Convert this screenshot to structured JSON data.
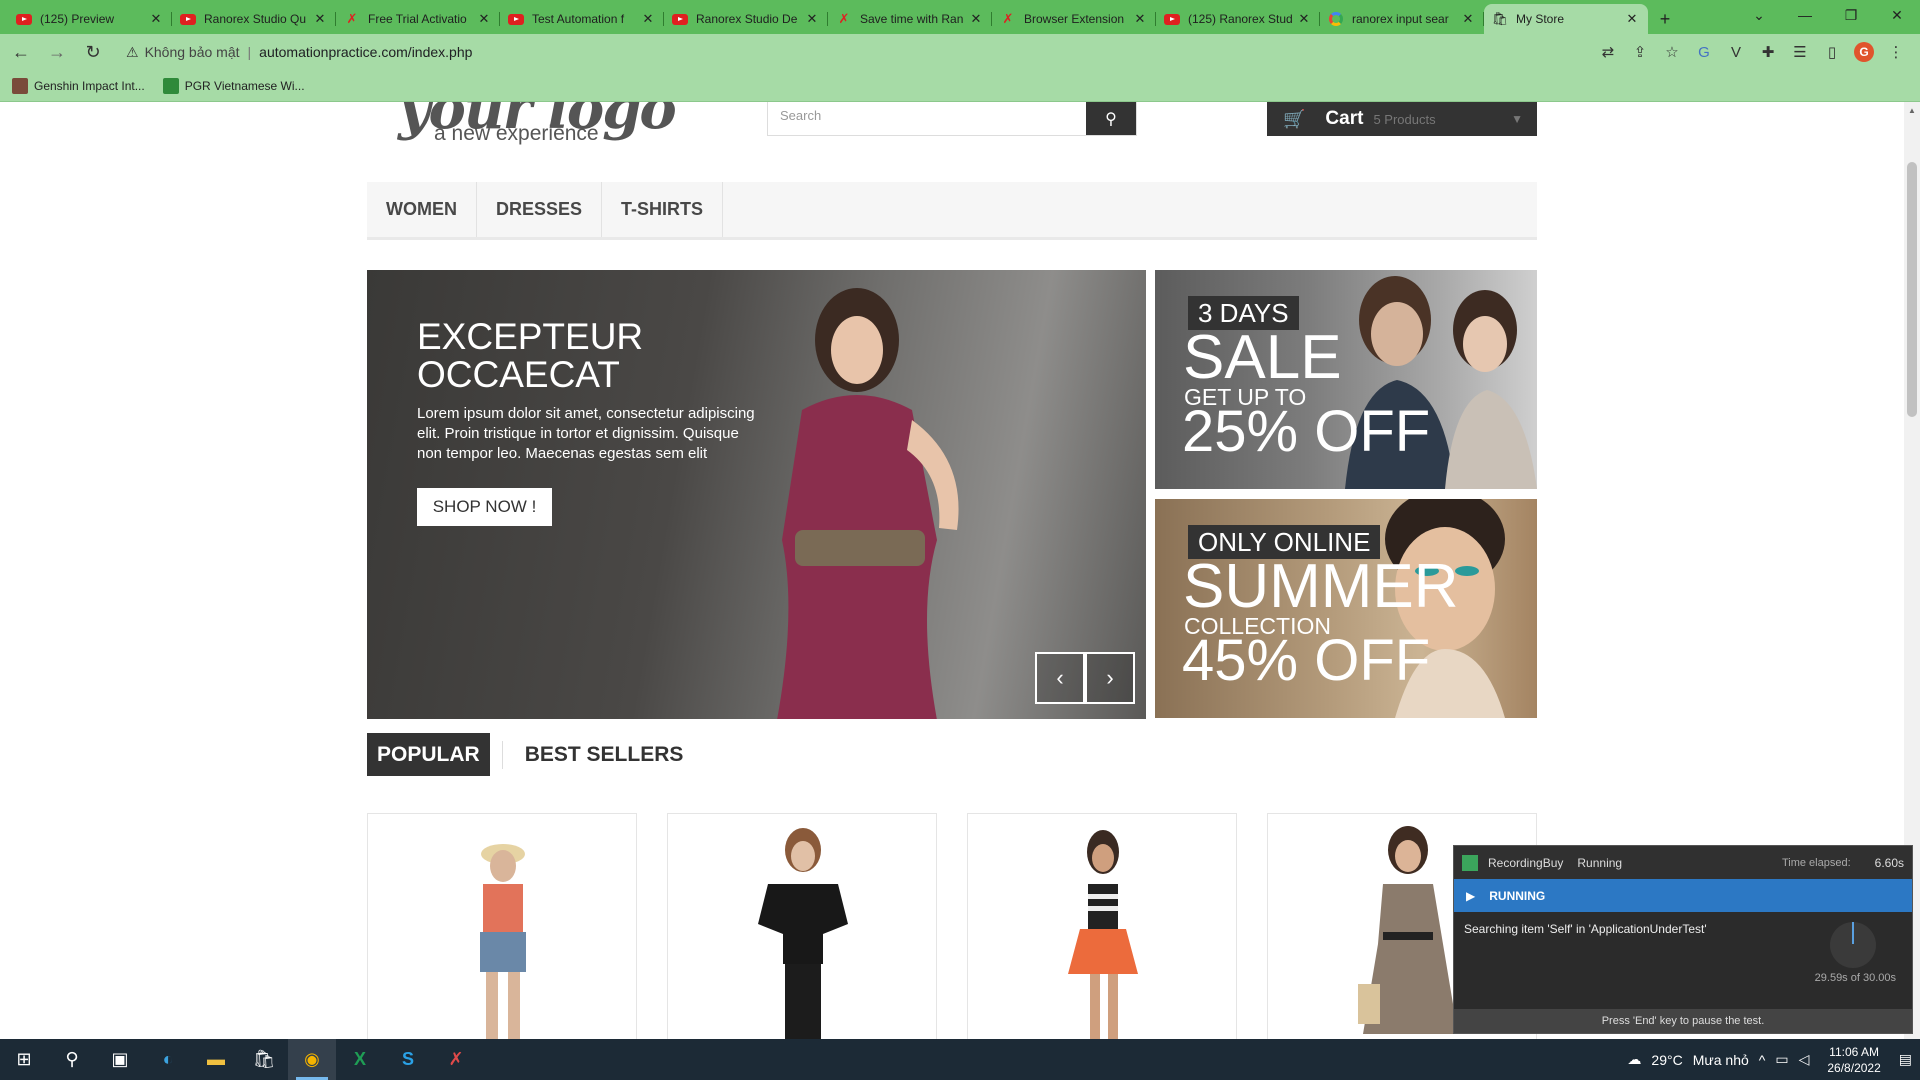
{
  "browser": {
    "tabs": [
      {
        "title": "(125) Preview",
        "icon": "youtube-icon",
        "active": false
      },
      {
        "title": "Ranorex Studio Qu",
        "icon": "youtube-icon",
        "active": false
      },
      {
        "title": "Free Trial Activatio",
        "icon": "ranorex-icon",
        "active": false
      },
      {
        "title": "Test Automation f",
        "icon": "youtube-icon",
        "active": false
      },
      {
        "title": "Ranorex Studio De",
        "icon": "youtube-icon",
        "active": false
      },
      {
        "title": "Save time with Ran",
        "icon": "ranorex-icon",
        "active": false
      },
      {
        "title": "Browser Extension",
        "icon": "ranorex-icon",
        "active": false
      },
      {
        "title": "(125) Ranorex Stud",
        "icon": "youtube-icon",
        "active": false
      },
      {
        "title": "ranorex input sear",
        "icon": "google-icon",
        "active": false
      },
      {
        "title": "My Store",
        "icon": "store-icon",
        "active": true
      }
    ],
    "security_label": "Không bảo mật",
    "url": "automationpractice.com/index.php",
    "bookmarks": [
      {
        "label": "Genshin Impact Int..."
      },
      {
        "label": "PGR Vietnamese Wi..."
      }
    ]
  },
  "store": {
    "logo_text": "your logo",
    "logo_sub": "a new experience",
    "search_placeholder": "Search",
    "cart_label": "Cart",
    "cart_count": "5 Products",
    "menu": [
      "WOMEN",
      "DRESSES",
      "T-SHIRTS"
    ],
    "hero": {
      "title": "EXCEPTEUR OCCAECAT",
      "text": "Lorem ipsum dolor sit amet, consectetur adipiscing elit. Proin tristique in tortor et dignissim. Quisque non tempor leo. Maecenas egestas sem elit",
      "button": "SHOP NOW !"
    },
    "banner1": {
      "tag": "3 DAYS",
      "big": "SALE",
      "mid": "GET UP TO",
      "pct": "25% OFF"
    },
    "banner2": {
      "tag": "ONLY ONLINE",
      "big": "SUMMER",
      "mid": "COLLECTION",
      "pct": "45% OFF"
    },
    "tabs": {
      "popular": "POPULAR",
      "bestsellers": "BEST SELLERS"
    }
  },
  "ranorex": {
    "test_name": "RecordingBuy",
    "state": "Running",
    "time_label": "Time elapsed:",
    "time_value": "6.60s",
    "bar_label": "RUNNING",
    "message": "Searching item 'Self' in 'ApplicationUnderTest'",
    "progress": "29.59s of 30.00s",
    "footer": "Press 'End' key to pause the test."
  },
  "taskbar": {
    "temperature": "29°C",
    "weather": "Mưa nhỏ",
    "time": "11:06 AM",
    "date": "26/8/2022"
  },
  "colors": {
    "tabstrip": "#5cbb5c",
    "toolbar": "#a6dba6",
    "taskbar": "#1c2a36",
    "ranorex_accent": "#2c78c4"
  }
}
